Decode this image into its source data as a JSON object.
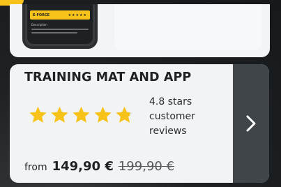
{
  "top_card": {
    "phone": {
      "brand": "E-FORCE",
      "stars": "★★★★★",
      "description_title": "Description"
    }
  },
  "product_card": {
    "title": "TRAINING MAT AND APP",
    "rating": {
      "stars_value": 4.8,
      "stars_max": 5,
      "line1": "4.8 stars",
      "line2": "customer",
      "line3": "reviews"
    },
    "price": {
      "from_label": "from",
      "current": "149,90 €",
      "old": "199,90 €"
    },
    "next_icon": "chevron-right-icon"
  },
  "colors": {
    "star": "#f7c31a",
    "accent_yellow": "#f7c31a",
    "dark_panel": "#3f4549",
    "card_bg": "#f2f3f5"
  }
}
